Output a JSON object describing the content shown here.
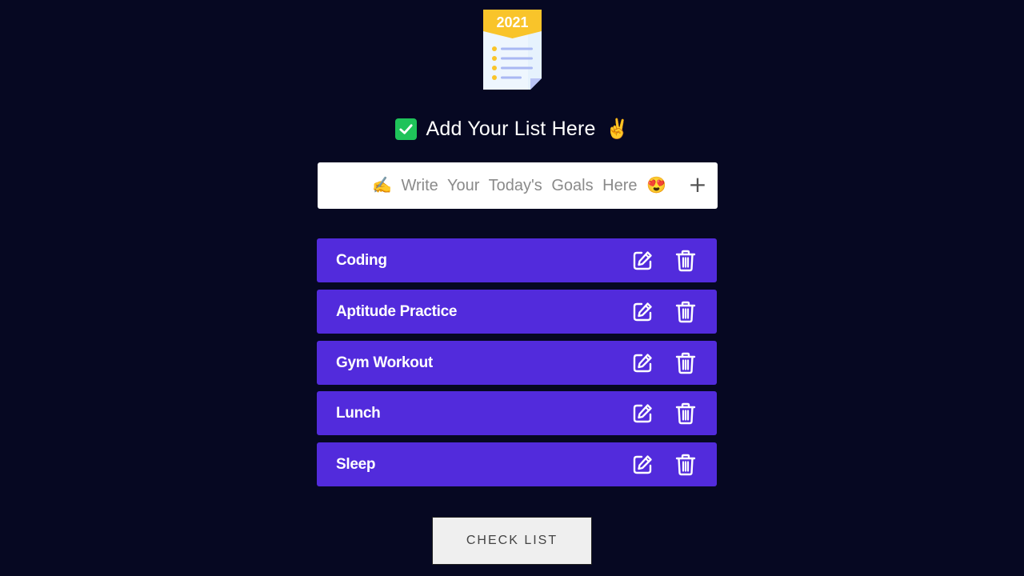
{
  "logo": {
    "year": "2021",
    "icon": "notepad-checklist-icon"
  },
  "header": {
    "title": "Add Your List Here",
    "leading_icon": "check-mark-button-icon",
    "trailing_icon": "victory-hand-icon",
    "trailing_emoji": "✌️"
  },
  "input": {
    "placeholder": "✍️ Write Your Today's Goals Here 😍",
    "value": "",
    "add_label": "+"
  },
  "tasks": [
    {
      "label": "Coding"
    },
    {
      "label": "Aptitude Practice"
    },
    {
      "label": "Gym Workout"
    },
    {
      "label": "Lunch"
    },
    {
      "label": "Sleep"
    }
  ],
  "footer": {
    "check_list_label": "CHECK LIST"
  },
  "colors": {
    "background": "#060822",
    "task_bg": "#522bdc",
    "check_green": "#1fc35a",
    "logo_banner": "#f9c42a"
  }
}
